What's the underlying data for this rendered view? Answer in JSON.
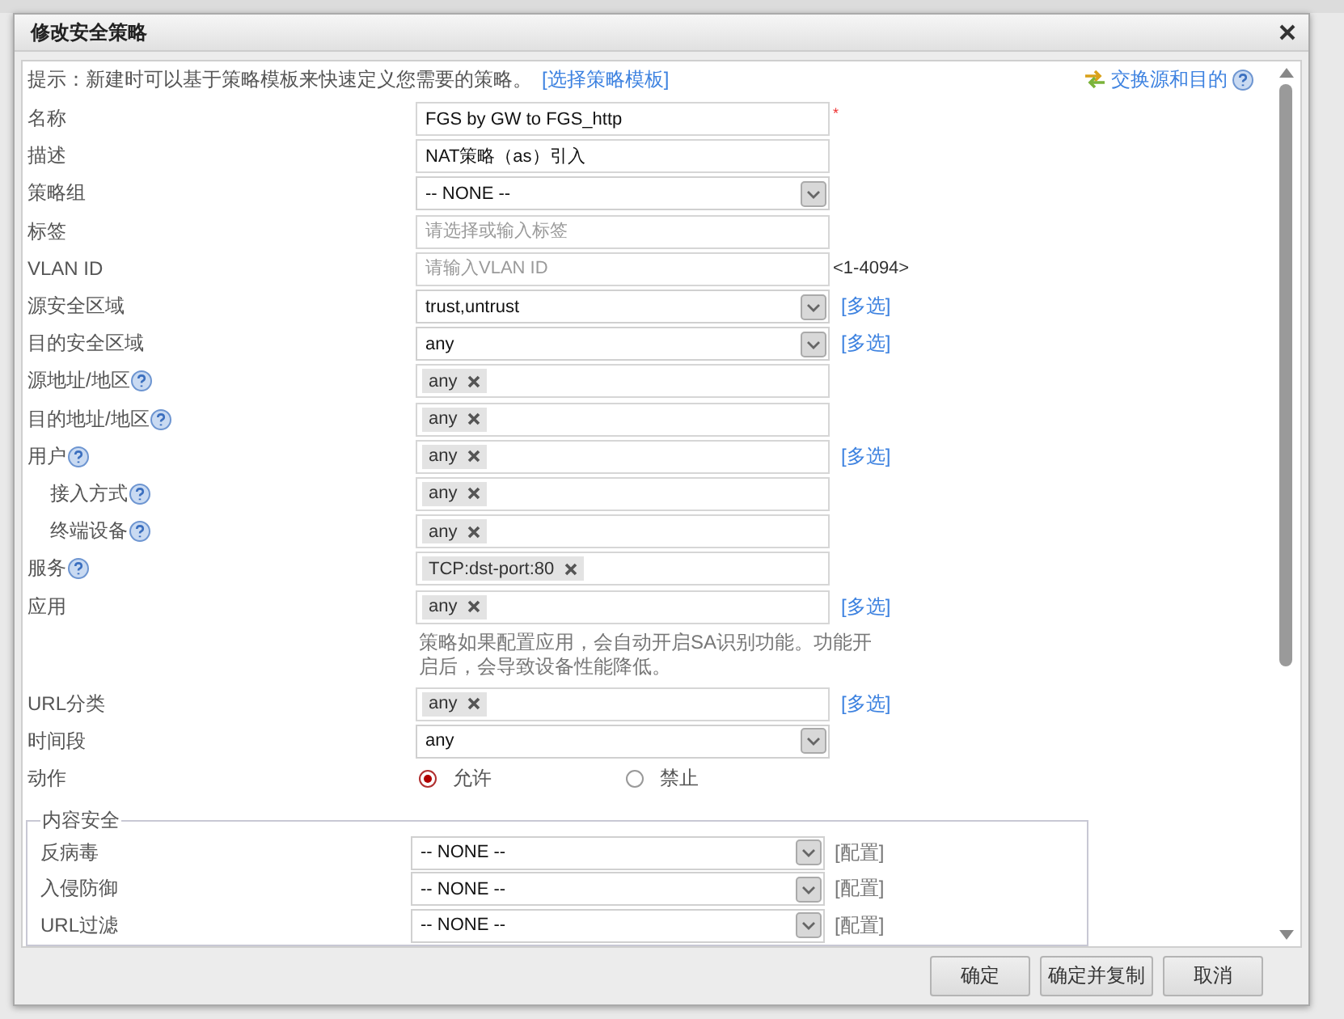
{
  "dialog": {
    "title": "修改安全策略"
  },
  "hint": {
    "text": "提示：新建时可以基于策略模板来快速定义您需要的策略。",
    "link": "[选择策略模板]"
  },
  "swap_link": "交换源和目的",
  "fields": [
    {
      "label": "名称",
      "kind": "text",
      "value": "FGS by GW to FGS_http",
      "required_mark": "*",
      "help": false
    },
    {
      "label": "描述",
      "kind": "text",
      "value": "NAT策略（as）引入",
      "help": false
    },
    {
      "label": "策略组",
      "kind": "select",
      "value": "-- NONE --",
      "help": false
    },
    {
      "label": "标签",
      "kind": "text",
      "placeholder": "请选择或输入标签",
      "help": false
    },
    {
      "label": "VLAN ID",
      "kind": "text",
      "placeholder": "请输入VLAN ID",
      "suffix": "<1-4094>",
      "help": false
    },
    {
      "label": "源安全区域",
      "kind": "select",
      "value": "trust,untrust",
      "link": "[多选]",
      "help": false
    },
    {
      "label": "目的安全区域",
      "kind": "select",
      "value": "any",
      "link": "[多选]",
      "help": false
    },
    {
      "label": "源地址/地区",
      "kind": "tags",
      "tags": [
        "any"
      ],
      "help": true
    },
    {
      "label": "目的地址/地区",
      "kind": "tags",
      "tags": [
        "any"
      ],
      "help": true
    },
    {
      "label": "用户",
      "kind": "tags",
      "tags": [
        "any"
      ],
      "link": "[多选]",
      "help": true,
      "children": [
        {
          "label": "接入方式",
          "kind": "tags",
          "tags": [
            "any"
          ],
          "help": true
        },
        {
          "label": "终端设备",
          "kind": "tags",
          "tags": [
            "any"
          ],
          "help": true
        }
      ]
    },
    {
      "label": "服务",
      "kind": "tags",
      "tags": [
        "TCP:dst-port:80"
      ],
      "help": true
    },
    {
      "label": "应用",
      "kind": "tags",
      "tags": [
        "any"
      ],
      "link": "[多选]",
      "note": "策略如果配置应用，会自动开启SA识别功能。功能开启后，会导致设备性能降低。",
      "help": false
    },
    {
      "label": "URL分类",
      "kind": "tags",
      "tags": [
        "any"
      ],
      "link": "[多选]",
      "help": false
    },
    {
      "label": "时间段",
      "kind": "select",
      "value": "any",
      "help": false
    },
    {
      "label": "动作",
      "kind": "radio",
      "options": [
        {
          "label": "允许",
          "selected": true
        },
        {
          "label": "禁止",
          "selected": false
        }
      ],
      "help": false
    }
  ],
  "content_security": {
    "legend": "内容安全",
    "rows": [
      {
        "label": "反病毒",
        "value": "-- NONE --",
        "link": "[配置]"
      },
      {
        "label": "入侵防御",
        "value": "-- NONE --",
        "link": "[配置]"
      },
      {
        "label": "URL过滤",
        "value": "-- NONE --",
        "link": "[配置]"
      }
    ]
  },
  "buttons": [
    "确定",
    "确定并复制",
    "取消"
  ]
}
